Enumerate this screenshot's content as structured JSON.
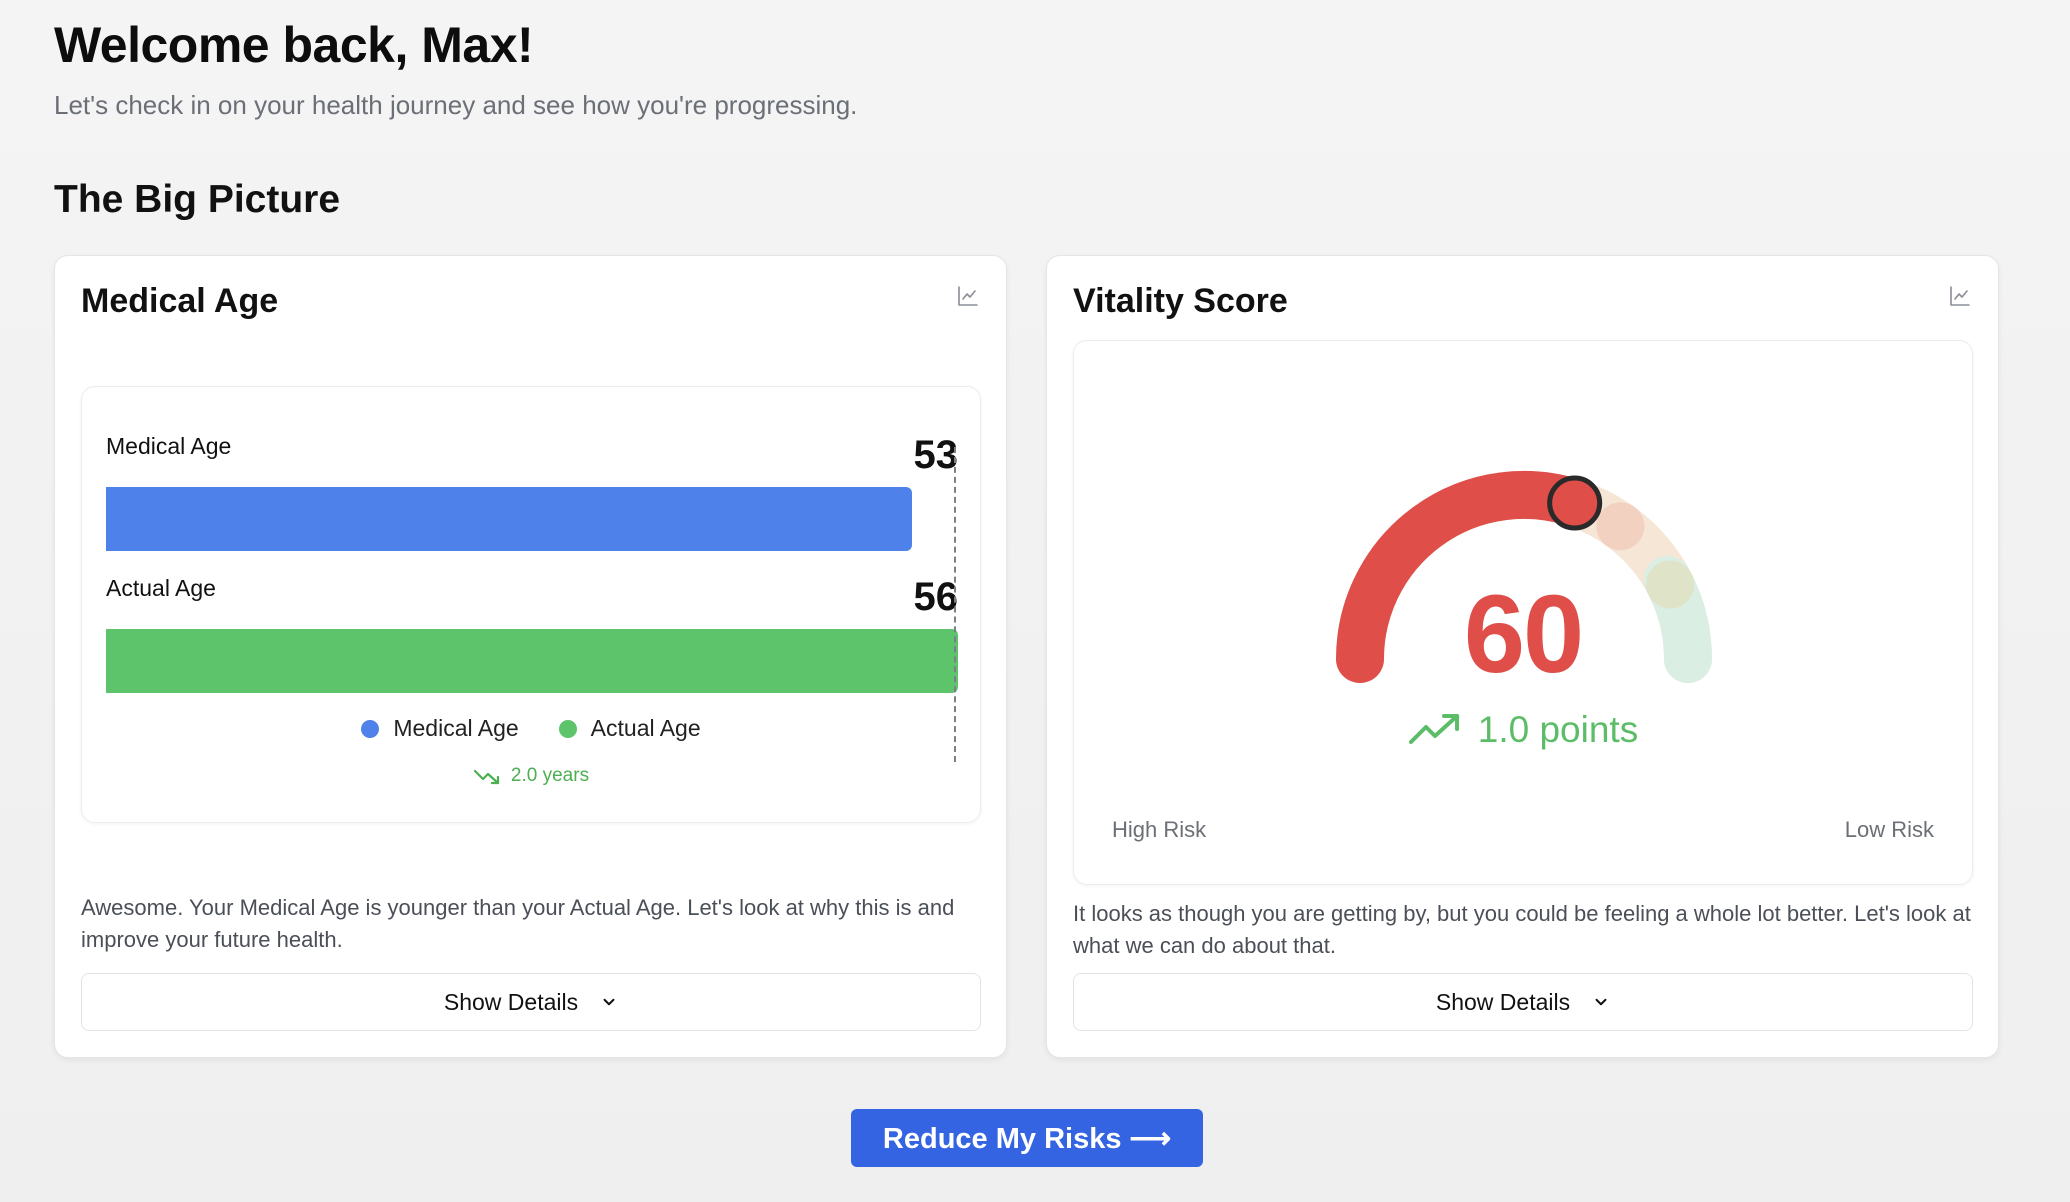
{
  "header": {
    "title": "Welcome back, Max!",
    "subtitle": "Let's check in on your health journey and see how you're progressing."
  },
  "section": {
    "title": "The Big Picture"
  },
  "medical_age_card": {
    "title": "Medical Age",
    "chart_icon": "line-chart-icon",
    "rows": [
      {
        "label": "Medical Age",
        "value": "53"
      },
      {
        "label": "Actual Age",
        "value": "56"
      }
    ],
    "legend": [
      {
        "label": "Medical Age",
        "color": "#4f81ea"
      },
      {
        "label": "Actual Age",
        "color": "#5ec46b"
      }
    ],
    "trend_icon": "trend-down-icon",
    "trend": "2.0 years",
    "description": "Awesome. Your Medical Age is younger than your Actual Age. Let's look at why this is and improve your future health.",
    "details_button": "Show Details",
    "details_icon": "chevron-down-icon"
  },
  "vitality_card": {
    "title": "Vitality Score",
    "chart_icon": "line-chart-icon",
    "score": "60",
    "score_color": "#df4e48",
    "change_icon": "trend-up-icon",
    "change": "1.0 points",
    "change_color": "#5bbd67",
    "high_risk_label": "High Risk",
    "low_risk_label": "Low Risk",
    "description": "It looks as though you are getting by, but you could be feeling a whole lot better. Let's look at what we can do about that.",
    "details_button": "Show Details",
    "details_icon": "chevron-down-icon"
  },
  "cta": {
    "label": "Reduce My Risks ⟶"
  },
  "chart_data": [
    {
      "type": "bar",
      "categories": [
        "Medical Age",
        "Actual Age"
      ],
      "values": [
        53,
        56
      ],
      "title": "Medical Age",
      "xlabel": "",
      "ylabel": "",
      "colors": [
        "#4f81ea",
        "#5ec46b"
      ],
      "legend": "bottom"
    },
    {
      "type": "gauge",
      "value": 60,
      "min_label": "High Risk",
      "max_label": "Low Risk",
      "title": "Vitality Score"
    }
  ]
}
